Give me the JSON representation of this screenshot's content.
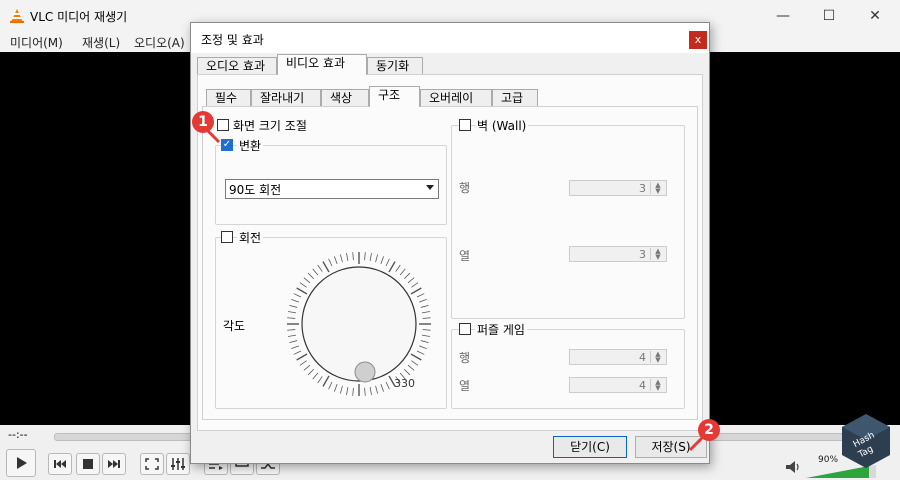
{
  "app": {
    "title": "VLC 미디어 재생기",
    "menu": [
      "미디어(M)",
      "재생(L)",
      "오디오(A)"
    ],
    "time_elapsed": "--:--",
    "time_total": "--:--",
    "volume_percent": "90%"
  },
  "dialog": {
    "title": "조정 및 효과",
    "close_label": "x",
    "main_tabs": [
      "오디오 효과",
      "비디오 효과",
      "동기화"
    ],
    "active_main_tab": "비디오 효과",
    "sub_tabs": [
      "필수",
      "잘라내기",
      "색상",
      "구조",
      "오버레이",
      "고급"
    ],
    "active_sub_tab": "구조",
    "resize_label": "화면 크기 조절",
    "transform": {
      "label": "변환",
      "checked": true,
      "selected": "90도 회전"
    },
    "rotate": {
      "label": "회전",
      "checked": false,
      "angle_label": "각도",
      "dial_value": "330"
    },
    "wall": {
      "label": "벽 (Wall)",
      "checked": false,
      "rows_label": "행",
      "rows_value": "3",
      "cols_label": "열",
      "cols_value": "3"
    },
    "puzzle": {
      "label": "퍼즐 게임",
      "checked": false,
      "rows_label": "행",
      "rows_value": "4",
      "cols_label": "열",
      "cols_value": "4"
    },
    "close_button": "닫기(C)",
    "save_button": "저장(S)"
  },
  "annotations": [
    "1",
    "2"
  ],
  "watermark": [
    "Hash",
    "Tag"
  ],
  "colors": {
    "accent": "#1f6fd1",
    "badge": "#e53935",
    "close": "#c42b1c",
    "video_bg": "#000000"
  }
}
